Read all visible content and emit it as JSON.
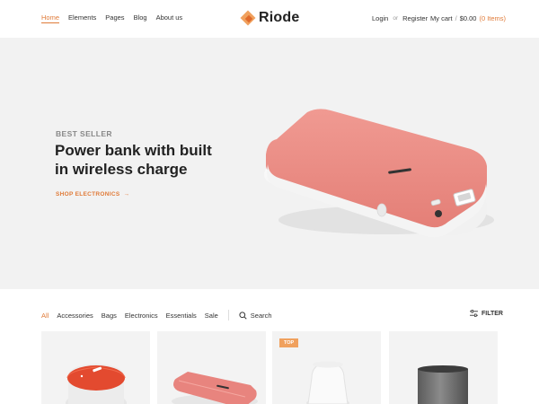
{
  "nav": {
    "items": [
      {
        "label": "Home",
        "active": true
      },
      {
        "label": "Elements",
        "active": false
      },
      {
        "label": "Pages",
        "active": false
      },
      {
        "label": "Blog",
        "active": false
      },
      {
        "label": "About us",
        "active": false
      }
    ]
  },
  "logo": {
    "text": "Riode"
  },
  "account": {
    "login": "Login",
    "or": "or",
    "register": "Register"
  },
  "cart": {
    "label": "My cart",
    "slash": "/",
    "total": "$0.00",
    "items": "(0 Items)"
  },
  "hero": {
    "eyebrow": "BEST SELLER",
    "title": "Power bank with built in wireless charge",
    "link": "SHOP ELECTRONICS",
    "link_arrow": "→"
  },
  "filters": {
    "categories": [
      {
        "label": "All",
        "active": true
      },
      {
        "label": "Accessories",
        "active": false
      },
      {
        "label": "Bags",
        "active": false
      },
      {
        "label": "Electronics",
        "active": false
      },
      {
        "label": "Essentials",
        "active": false
      },
      {
        "label": "Sale",
        "active": false
      }
    ],
    "search_label": "Search",
    "filter_label": "FILTER"
  },
  "products": [
    {
      "name": "speaker",
      "badge": ""
    },
    {
      "name": "power-bank",
      "badge": ""
    },
    {
      "name": "smart-speaker",
      "badge": "TOP"
    },
    {
      "name": "cylinder-speaker",
      "badge": ""
    }
  ],
  "colors": {
    "accent": "#e07b39",
    "brand": "#f0a15e",
    "hero_bg": "#f2f2f2",
    "product_red": "#e8847e"
  }
}
